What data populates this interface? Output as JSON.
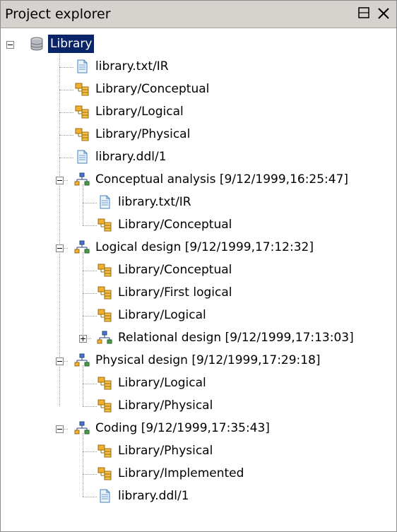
{
  "panel": {
    "title": "Project explorer"
  },
  "tree": {
    "root_label": "Library",
    "items": [
      {
        "label": "library.txt/IR",
        "icon": "document-icon"
      },
      {
        "label": "Library/Conceptual",
        "icon": "schema-icon"
      },
      {
        "label": "Library/Logical",
        "icon": "schema-icon"
      },
      {
        "label": "Library/Physical",
        "icon": "schema-icon"
      },
      {
        "label": "library.ddl/1",
        "icon": "document-icon"
      },
      {
        "label": "Conceptual analysis [9/12/1999,16:25:47]",
        "icon": "process-icon",
        "expander": "minus"
      },
      {
        "label": "library.txt/IR",
        "icon": "document-icon"
      },
      {
        "label": "Library/Conceptual",
        "icon": "schema-icon"
      },
      {
        "label": "Logical design [9/12/1999,17:12:32]",
        "icon": "process-icon",
        "expander": "minus"
      },
      {
        "label": "Library/Conceptual",
        "icon": "schema-icon"
      },
      {
        "label": "Library/First logical",
        "icon": "schema-icon"
      },
      {
        "label": "Library/Logical",
        "icon": "schema-icon"
      },
      {
        "label": "Relational design [9/12/1999,17:13:03]",
        "icon": "process-icon",
        "expander": "plus"
      },
      {
        "label": "Physical design [9/12/1999,17:29:18]",
        "icon": "process-icon",
        "expander": "minus"
      },
      {
        "label": "Library/Logical",
        "icon": "schema-icon"
      },
      {
        "label": "Library/Physical",
        "icon": "schema-icon"
      },
      {
        "label": "Coding [9/12/1999,17:35:43]",
        "icon": "process-icon",
        "expander": "minus"
      },
      {
        "label": "Library/Physical",
        "icon": "schema-icon"
      },
      {
        "label": "Library/Implemented",
        "icon": "schema-icon"
      },
      {
        "label": "library.ddl/1",
        "icon": "document-icon"
      }
    ]
  },
  "colors": {
    "selection": "#0a246a",
    "titlebar": "#d6d3ce"
  }
}
